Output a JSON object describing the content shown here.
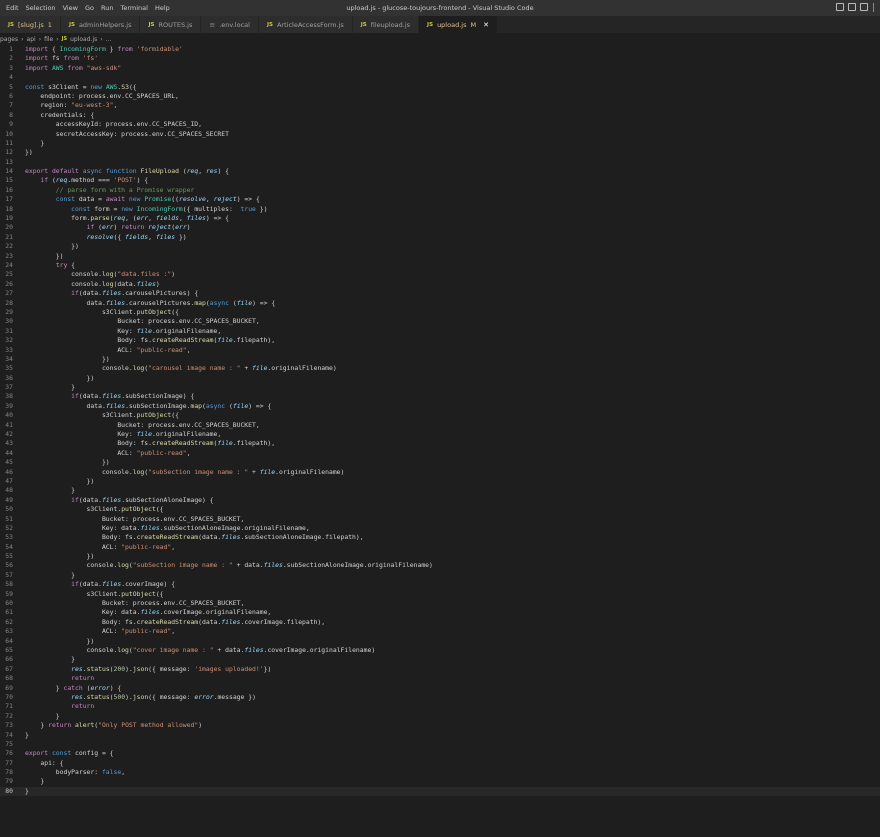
{
  "titlebar": {
    "menu": [
      "Edit",
      "Selection",
      "View",
      "Go",
      "Run",
      "Terminal",
      "Help"
    ],
    "window_title": "upload.js - glucose-toujours-frontend - Visual Studio Code"
  },
  "tabs": [
    {
      "icon": "JS",
      "label": "[slug].js",
      "suffix": "1"
    },
    {
      "icon": "JS",
      "label": "adminHelpers.js",
      "suffix": ""
    },
    {
      "icon": "JS",
      "label": "ROUTES.js",
      "suffix": ""
    },
    {
      "icon": "≡",
      "label": ".env.local",
      "suffix": ""
    },
    {
      "icon": "JS",
      "label": "ArticleAccessForm.js",
      "suffix": ""
    },
    {
      "icon": "JS",
      "label": "fileupload.js",
      "suffix": ""
    },
    {
      "icon": "JS",
      "label": "upload.js",
      "suffix": "M"
    }
  ],
  "breadcrumb": [
    "pages",
    "api",
    "file",
    "upload.js",
    "..."
  ],
  "breadcrumb_icon": "JS",
  "editor": {
    "current_line": 80,
    "lines": [
      "import { IncomingForm } from 'formidable'",
      "import fs from 'fs'",
      "import AWS from \"aws-sdk\"",
      "",
      "const s3Client = new AWS.S3({",
      "    endpoint: process.env.CC_SPACES_URL,",
      "    region: \"eu-west-3\",",
      "    credentials: {",
      "        accessKeyId: process.env.CC_SPACES_ID,",
      "        secretAccessKey: process.env.CC_SPACES_SECRET",
      "    }",
      "})",
      "",
      "export default async function FileUpload (req, res) {",
      "    if (req.method === 'POST') {",
      "        // parse form with a Promise wrapper",
      "        const data = await new Promise((resolve, reject) => {",
      "            const form = new IncomingForm({ multiples:  true })",
      "            form.parse(req, (err, fields, files) => {",
      "                if (err) return reject(err)",
      "                resolve({ fields, files })",
      "            })",
      "        })",
      "        try {",
      "            console.log(\"data.files :\")",
      "            console.log(data.files)",
      "            if(data.files.carouselPictures) {",
      "                data.files.carouselPictures.map(async (file) => {",
      "                    s3Client.putObject({",
      "                        Bucket: process.env.CC_SPACES_BUCKET,",
      "                        Key: file.originalFilename,",
      "                        Body: fs.createReadStream(file.filepath),",
      "                        ACL: \"public-read\",",
      "                    })",
      "                    console.log(\"carousel image name : \" + file.originalFilename)",
      "                })",
      "            }",
      "            if(data.files.subSectionImage) {",
      "                data.files.subSectionImage.map(async (file) => {",
      "                    s3Client.putObject({",
      "                        Bucket: process.env.CC_SPACES_BUCKET,",
      "                        Key: file.originalFilename,",
      "                        Body: fs.createReadStream(file.filepath),",
      "                        ACL: \"public-read\",",
      "                    })",
      "                    console.log(\"subSection image name : \" + file.originalFilename)",
      "                })",
      "            }",
      "            if(data.files.subSectionAloneImage) {",
      "                s3Client.putObject({",
      "                    Bucket: process.env.CC_SPACES_BUCKET,",
      "                    Key: data.files.subSectionAloneImage.originalFilename,",
      "                    Body: fs.createReadStream(data.files.subSectionAloneImage.filepath),",
      "                    ACL: \"public-read\",",
      "                })",
      "                console.log(\"subSection image name : \" + data.files.subSectionAloneImage.originalFilename)",
      "            }",
      "            if(data.files.coverImage) {",
      "                s3Client.putObject({",
      "                    Bucket: process.env.CC_SPACES_BUCKET,",
      "                    Key: data.files.coverImage.originalFilename,",
      "                    Body: fs.createReadStream(data.files.coverImage.filepath),",
      "                    ACL: \"public-read\",",
      "                })",
      "                console.log(\"cover image name : \" + data.files.coverImage.originalFilename)",
      "            }",
      "            res.status(200).json({ message: 'images uploaded!'})",
      "            return",
      "        } catch (error) {",
      "            res.status(500).json({ message: error.message })",
      "            return",
      "        }",
      "    } return alert(\"Only POST method allowed\")",
      "}",
      "",
      "export const config = {",
      "    api: {",
      "        bodyParser: false,",
      "    }",
      "}"
    ]
  }
}
